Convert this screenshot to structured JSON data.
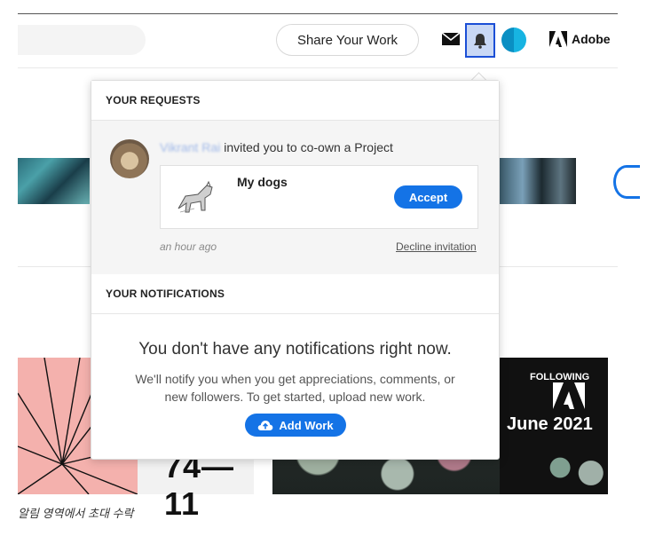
{
  "header": {
    "share_label": "Share Your Work",
    "brand_label": "Adobe"
  },
  "background": {
    "mid_tile_text": "74—11",
    "following_label": "FOLLOWING",
    "june_label": "June 2021"
  },
  "popup": {
    "requests_heading": "YOUR REQUESTS",
    "request": {
      "requester_name": "Vikrant Rai",
      "message": "invited you to co-own a Project",
      "project_name": "My dogs",
      "accept_label": "Accept",
      "time_ago": "an hour ago",
      "decline_label": "Decline invitation"
    },
    "notifications_heading": "YOUR NOTIFICATIONS",
    "empty_title": "You don't have any notifications right now.",
    "empty_description": "We'll notify you when you get appreciations, comments, or new followers. To get started, upload new work.",
    "add_work_label": "Add Work"
  },
  "caption": "알림 영역에서 초대 수락",
  "colors": {
    "accent": "#1473e6",
    "bell_active_bg": "#c9d8f5"
  }
}
